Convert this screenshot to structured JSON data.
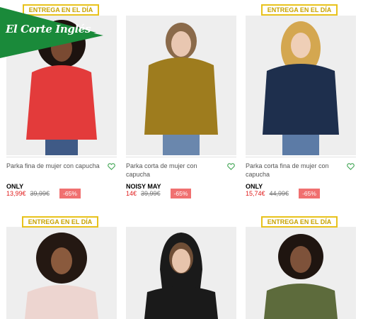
{
  "logo": {
    "text": "El Corte Inglés"
  },
  "badge_text": "ENTREGA EN EL DÍA",
  "products": [
    {
      "title": "Parka fina de mujer con capucha",
      "brand": "ONLY",
      "price": "13,99€",
      "old_price": "39,99€",
      "discount": "-65%",
      "swatches": [
        "#ffffff",
        "#d42c2c",
        "#f1c04a"
      ],
      "colors": {
        "coat": "#e33b3b",
        "skin": "#7a4a32",
        "hair": "#1d130f",
        "pants": "#3f5a86"
      }
    },
    {
      "title": "Parka corta de mujer con capucha",
      "brand": "NOISY MAY",
      "price": "14€",
      "old_price": "39,99€",
      "discount": "-65%",
      "swatches": [
        "#111111",
        "#5a3520"
      ],
      "colors": {
        "coat": "#9e7c1e",
        "skin": "#e9c7b1",
        "hair": "#8a6a4a",
        "pants": "#6a87ad"
      }
    },
    {
      "title": "Parka corta fina de mujer con capucha",
      "brand": "ONLY",
      "price": "15,74€",
      "old_price": "44,99€",
      "discount": "-65%",
      "swatches": [
        "#8a8a1e",
        "#2c7fd0"
      ],
      "colors": {
        "coat": "#1e2f4d",
        "skin": "#efcfb7",
        "hair": "#d4a750",
        "pants": "#5c7ba6"
      }
    },
    {
      "colors": {
        "coat": "#edd5d0",
        "skin": "#8a5a3d",
        "hair": "#241812"
      }
    },
    {
      "colors": {
        "coat": "#1a1a1a",
        "skin": "#e7c4ac",
        "hair": "#6f4e36"
      }
    },
    {
      "colors": {
        "coat": "#5d6b3c",
        "skin": "#7e523a",
        "hair": "#1f1510"
      }
    }
  ]
}
